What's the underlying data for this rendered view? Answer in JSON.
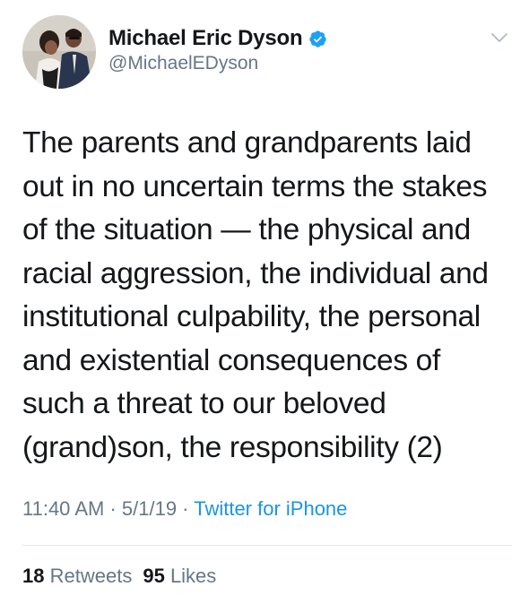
{
  "author": {
    "display_name": "Michael Eric Dyson",
    "handle": "@MichaelEDyson",
    "verified": true
  },
  "tweet": {
    "text": "The parents and grandparents laid\nout in no uncertain terms the stakes\nof the situation — the physical and\nracial aggression, the individual and\ninstitutional culpability, the personal\nand existential consequences of\nsuch a threat to our beloved\n(grand)son, the responsibility (2)"
  },
  "meta": {
    "time": "11:40 AM",
    "separator": " · ",
    "date": "5/1/19",
    "source": "Twitter for iPhone"
  },
  "stats": {
    "retweets_count": "18",
    "retweets_label": "Retweets",
    "likes_count": "95",
    "likes_label": "Likes"
  },
  "colors": {
    "verified_blue": "#1da1f2",
    "link_blue": "#1b95e0",
    "secondary_gray": "#657786",
    "divider": "#e1e8ed"
  },
  "icons": {
    "verified": "verified-badge-icon",
    "menu": "chevron-down-icon"
  }
}
